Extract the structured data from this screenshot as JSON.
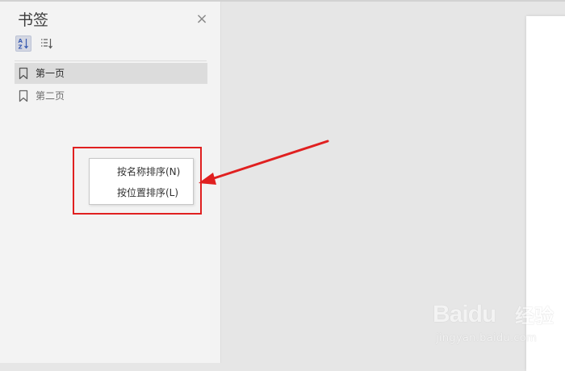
{
  "panel": {
    "title": "书签",
    "close_glyph": "×",
    "sort_buttons": [
      {
        "icon": "sort-alpha-icon",
        "active": true
      },
      {
        "icon": "sort-list-icon",
        "active": false
      }
    ]
  },
  "bookmarks": [
    {
      "label": "第一页",
      "selected": true
    },
    {
      "label": "第二页",
      "selected": false
    }
  ],
  "context_menu": {
    "items": [
      {
        "label": "按名称排序(N)"
      },
      {
        "label": "按位置排序(L)"
      }
    ]
  },
  "watermark": {
    "logo": "Baidu",
    "jingyan": "经验",
    "url": "jingyan.baidu.com"
  },
  "colors": {
    "annotation_red": "#e02020",
    "panel_bg": "#f3f3f3",
    "selected_bg": "#dcdcdc",
    "canvas_bg": "#e6e6e6"
  }
}
